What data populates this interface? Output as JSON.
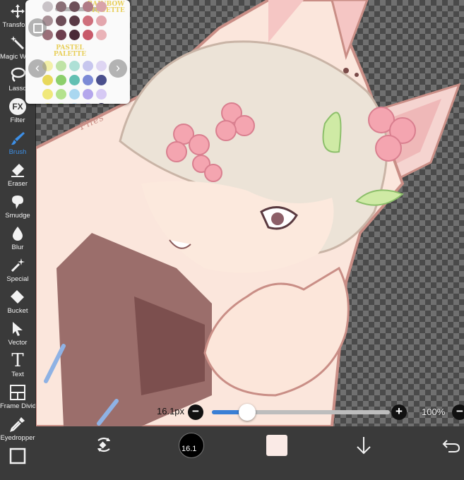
{
  "toolbar": {
    "tools": [
      {
        "name": "transform",
        "label": "Transform",
        "icon": "move-arrows-icon"
      },
      {
        "name": "magic-wand",
        "label": "Magic Wand",
        "icon": "magic-wand-icon"
      },
      {
        "name": "lasso",
        "label": "Lasso",
        "icon": "lasso-icon"
      },
      {
        "name": "filter",
        "label": "Filter",
        "icon": "fx-icon"
      },
      {
        "name": "brush",
        "label": "Brush",
        "icon": "brush-icon",
        "active": true
      },
      {
        "name": "eraser",
        "label": "Eraser",
        "icon": "eraser-icon"
      },
      {
        "name": "smudge",
        "label": "Smudge",
        "icon": "smudge-icon"
      },
      {
        "name": "blur",
        "label": "Blur",
        "icon": "drop-icon"
      },
      {
        "name": "special",
        "label": "Special",
        "icon": "sparkle-wand-icon"
      },
      {
        "name": "bucket",
        "label": "Bucket",
        "icon": "bucket-icon"
      },
      {
        "name": "vector",
        "label": "Vector",
        "icon": "cursor-arrow-icon"
      },
      {
        "name": "text",
        "label": "Text",
        "icon": "text-t-icon"
      },
      {
        "name": "frame-divider",
        "label": "Frame Divider",
        "icon": "frame-divider-icon"
      },
      {
        "name": "eyedropper",
        "label": "Eyedropper",
        "icon": "eyedropper-icon"
      },
      {
        "name": "canvas",
        "label": "",
        "icon": "canvas-square-icon"
      }
    ],
    "fx_text": "FX",
    "text_glyph": "T"
  },
  "palette": {
    "title1_line1": "RAINBOW",
    "title1_line2": "PIQUETTE",
    "title2_line1": "PASTEL",
    "title2_line2": "PALETTE",
    "prev_glyph": "‹",
    "next_glyph": "›",
    "rows_top": [
      [
        "#c9c3c7",
        "#8a6f76",
        "#6d4f58",
        "#b07b86",
        "#d9a3a9"
      ],
      [
        "#a78f95",
        "#6e4e58",
        "#5a3a45",
        "#cf6f7c",
        "#e3a6ad"
      ],
      [
        "#9a6e78",
        "#6d3f4e",
        "#4a2a37",
        "#c85a6a",
        "#eab3b8"
      ]
    ],
    "rows_bottom": [
      [
        "#f3f0a8",
        "#bfe3a6",
        "#aee0d6",
        "#c7c6ee",
        "#ded5f2"
      ],
      [
        "#e8d85a",
        "#8ccf6b",
        "#62bfb2",
        "#7c8ad6",
        "#4a4f8c"
      ],
      [
        "#f0e87a",
        "#b4e28d",
        "#a9d7f0",
        "#b4a6ec",
        "#d6c9f4"
      ],
      [
        "#f7f2b2",
        "#cdeeb6",
        "#c8e3f7",
        "#d0c8f3",
        "#23234a"
      ]
    ]
  },
  "brush": {
    "size_label": "16.1px",
    "size_fraction": 0.2,
    "minus_glyph": "−",
    "plus_glyph": "+",
    "zoom_label": "100%",
    "current_size_text": "16.1"
  },
  "canvas": {
    "signature": "Flies"
  },
  "colors": {
    "accent": "#3d8fe6",
    "toolbar_bg": "#3a3a3a",
    "secondary_color": "#faeae6",
    "primary_color": "#000000"
  },
  "bottombar": {
    "items": [
      "swap-colors-icon",
      "brush-size-indicator",
      "color-square",
      "download-arrow-icon",
      "undo-icon"
    ]
  }
}
